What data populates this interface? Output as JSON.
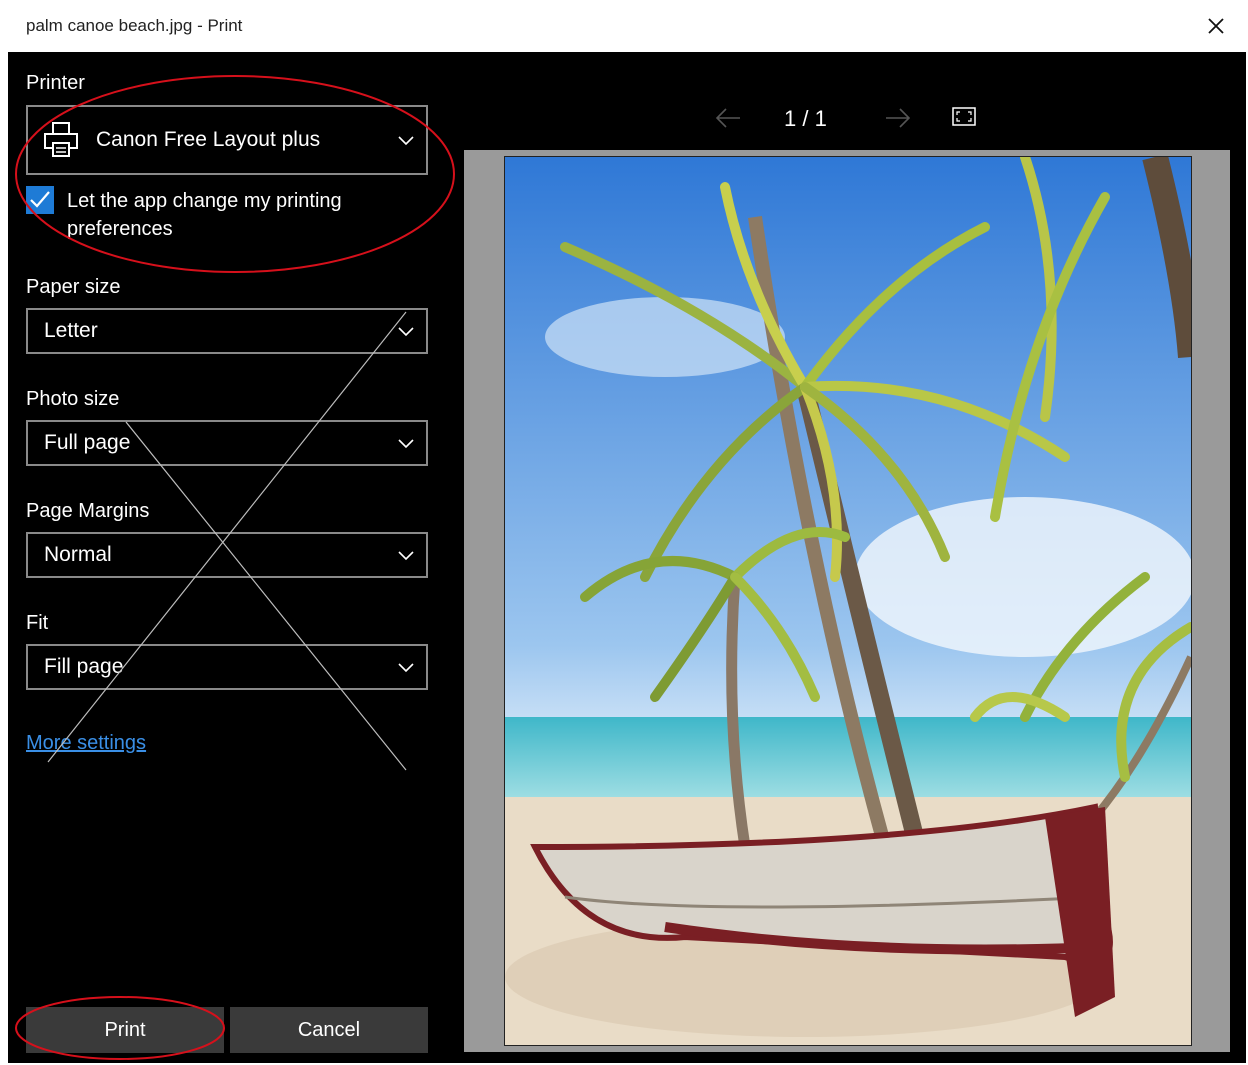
{
  "window": {
    "title": "palm canoe beach.jpg - Print",
    "close_icon": "close-icon"
  },
  "printer": {
    "label": "Printer",
    "value": "Canon Free Layout plus",
    "icon": "printer-icon",
    "let_app_change": {
      "label": "Let the app change my printing preferences",
      "checked": true
    }
  },
  "paper_size": {
    "label": "Paper size",
    "value": "Letter"
  },
  "photo_size": {
    "label": "Photo size",
    "value": "Full page"
  },
  "page_margins": {
    "label": "Page Margins",
    "value": "Normal"
  },
  "fit": {
    "label": "Fit",
    "value": "Fill page"
  },
  "more_settings": "More settings",
  "buttons": {
    "print": "Print",
    "cancel": "Cancel"
  },
  "preview": {
    "page_indicator": "1 / 1",
    "prev_icon": "arrow-left-icon",
    "next_icon": "arrow-right-icon",
    "fullscreen_icon": "fullscreen-icon"
  },
  "colors": {
    "background": "#000000",
    "accent": "#1e7bd6",
    "link": "#3a8fe6",
    "annotation": "#d6101b"
  }
}
